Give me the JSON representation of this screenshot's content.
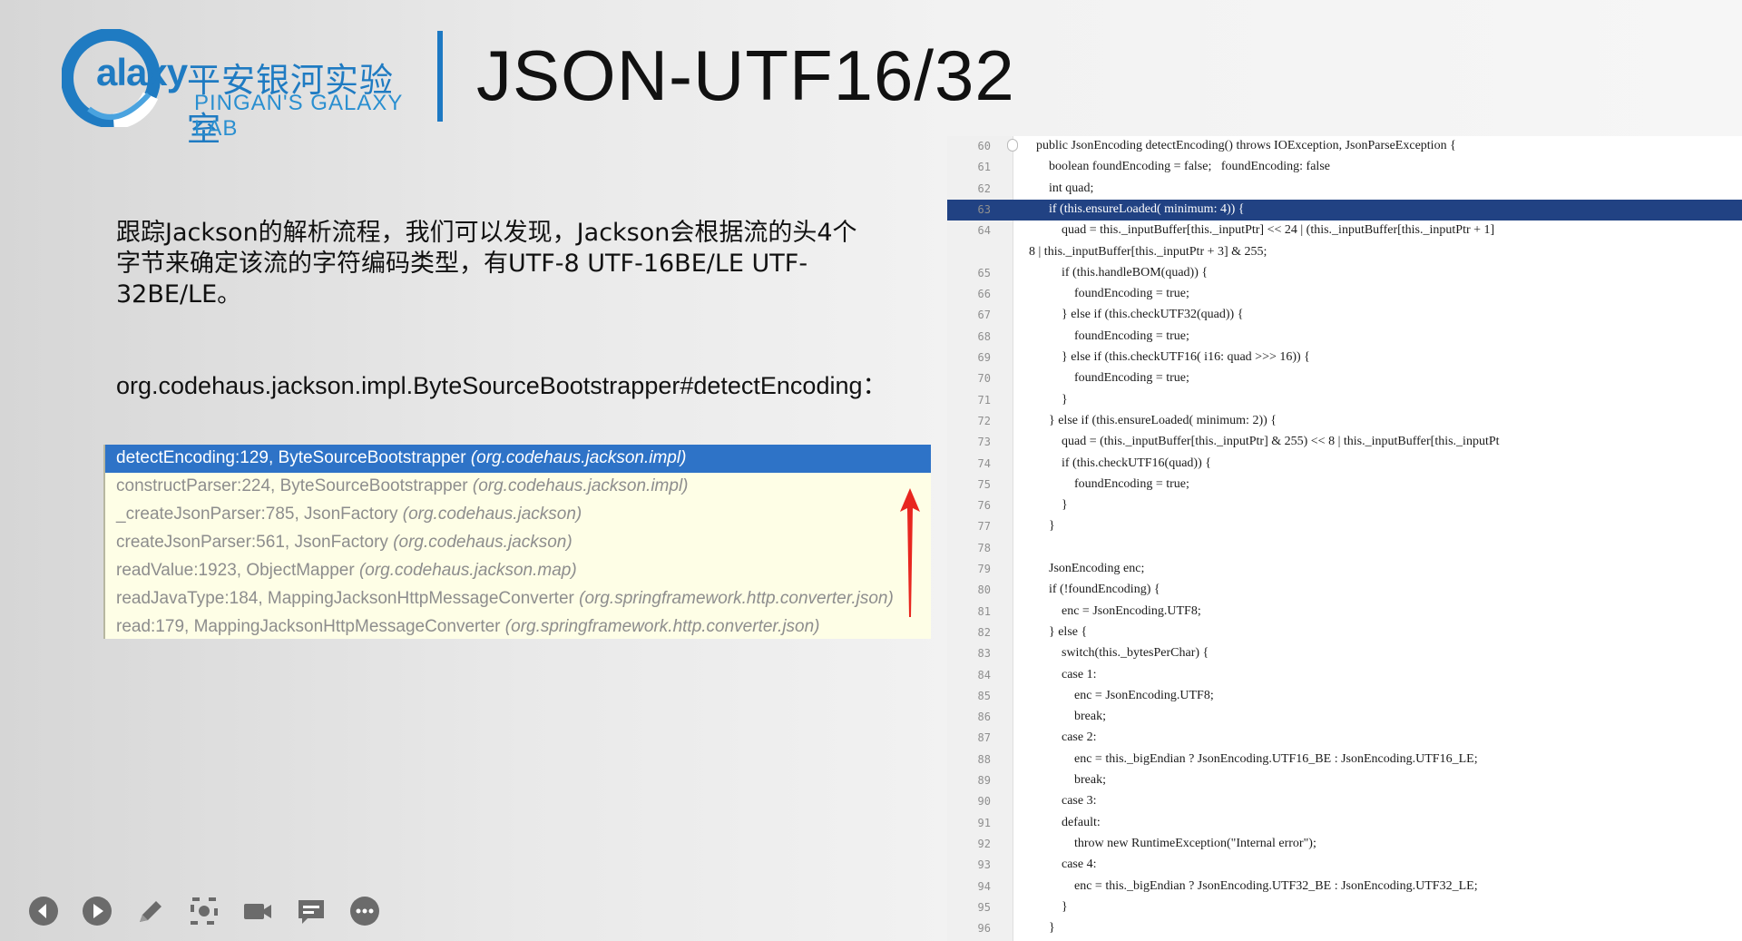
{
  "slide": {
    "logo_word": "Galaxy",
    "logo_cn": "平安银河实验室",
    "logo_en": "PINGAN'S GALAXY LAB",
    "title": "JSON-UTF16/32",
    "paragraph": "跟踪Jackson的解析流程，我们可以发现，Jackson会根据流的头4个字节来确定该流的字符编码类型，有UTF-8 UTF-16BE/LE UTF-32BE/LE。",
    "classpath": "org.codehaus.jackson.impl.ByteSourceBootstrapper#detectEncoding："
  },
  "stack_frames": [
    {
      "method": "detectEncoding:129, ByteSourceBootstrapper ",
      "pkg": "(org.codehaus.jackson.impl)"
    },
    {
      "method": "constructParser:224, ByteSourceBootstrapper ",
      "pkg": "(org.codehaus.jackson.impl)"
    },
    {
      "method": "_createJsonParser:785, JsonFactory ",
      "pkg": "(org.codehaus.jackson)"
    },
    {
      "method": "createJsonParser:561, JsonFactory ",
      "pkg": "(org.codehaus.jackson)"
    },
    {
      "method": "readValue:1923, ObjectMapper ",
      "pkg": "(org.codehaus.jackson.map)"
    },
    {
      "method": "readJavaType:184, MappingJacksonHttpMessageConverter ",
      "pkg": "(org.springframework.http.converter.json)"
    },
    {
      "method": "read:179, MappingJacksonHttpMessageConverter ",
      "pkg": "(org.springframework.http.converter.json)"
    }
  ],
  "code_lines": [
    {
      "n": "60",
      "t": "    public JsonEncoding detectEncoding() throws IOException, JsonParseException {"
    },
    {
      "n": "61",
      "t": "        boolean foundEncoding = false;   foundEncoding: false"
    },
    {
      "n": "62",
      "t": "        int quad;"
    },
    {
      "n": "63",
      "t": "        if (this.ensureLoaded( minimum: 4)) {"
    },
    {
      "n": "64",
      "t": "            quad = this._inputBuffer[this._inputPtr] << 24 | (this._inputBuffer[this._inputPtr + 1]"
    },
    {
      "n": "",
      "t": "8 | this._inputBuffer[this._inputPtr + 3] & 255;"
    },
    {
      "n": "65",
      "t": "            if (this.handleBOM(quad)) {"
    },
    {
      "n": "66",
      "t": "                foundEncoding = true;"
    },
    {
      "n": "67",
      "t": "            } else if (this.checkUTF32(quad)) {"
    },
    {
      "n": "68",
      "t": "                foundEncoding = true;"
    },
    {
      "n": "69",
      "t": "            } else if (this.checkUTF16( i16: quad >>> 16)) {"
    },
    {
      "n": "70",
      "t": "                foundEncoding = true;"
    },
    {
      "n": "71",
      "t": "            }"
    },
    {
      "n": "72",
      "t": "        } else if (this.ensureLoaded( minimum: 2)) {"
    },
    {
      "n": "73",
      "t": "            quad = (this._inputBuffer[this._inputPtr] & 255) << 8 | this._inputBuffer[this._inputPt"
    },
    {
      "n": "74",
      "t": "            if (this.checkUTF16(quad)) {"
    },
    {
      "n": "75",
      "t": "                foundEncoding = true;"
    },
    {
      "n": "76",
      "t": "            }"
    },
    {
      "n": "77",
      "t": "        }"
    },
    {
      "n": "78",
      "t": ""
    },
    {
      "n": "79",
      "t": "        JsonEncoding enc;"
    },
    {
      "n": "80",
      "t": "        if (!foundEncoding) {"
    },
    {
      "n": "81",
      "t": "            enc = JsonEncoding.UTF8;"
    },
    {
      "n": "82",
      "t": "        } else {"
    },
    {
      "n": "83",
      "t": "            switch(this._bytesPerChar) {"
    },
    {
      "n": "84",
      "t": "            case 1:"
    },
    {
      "n": "85",
      "t": "                enc = JsonEncoding.UTF8;"
    },
    {
      "n": "86",
      "t": "                break;"
    },
    {
      "n": "87",
      "t": "            case 2:"
    },
    {
      "n": "88",
      "t": "                enc = this._bigEndian ? JsonEncoding.UTF16_BE : JsonEncoding.UTF16_LE;"
    },
    {
      "n": "89",
      "t": "                break;"
    },
    {
      "n": "90",
      "t": "            case 3:"
    },
    {
      "n": "91",
      "t": "            default:"
    },
    {
      "n": "92",
      "t": "                throw new RuntimeException(\"Internal error\");"
    },
    {
      "n": "93",
      "t": "            case 4:"
    },
    {
      "n": "94",
      "t": "                enc = this._bigEndian ? JsonEncoding.UTF32_BE : JsonEncoding.UTF32_LE;"
    },
    {
      "n": "95",
      "t": "            }"
    },
    {
      "n": "96",
      "t": "        }"
    }
  ],
  "toolbar": [
    "previous-icon",
    "play-icon",
    "pen-icon",
    "focus-icon",
    "camera-icon",
    "comment-icon",
    "more-icon"
  ],
  "colors": {
    "brand": "#1f7bc2",
    "selection": "#2e73c7",
    "code_highlight": "#214283",
    "arrow": "#e8261f"
  }
}
